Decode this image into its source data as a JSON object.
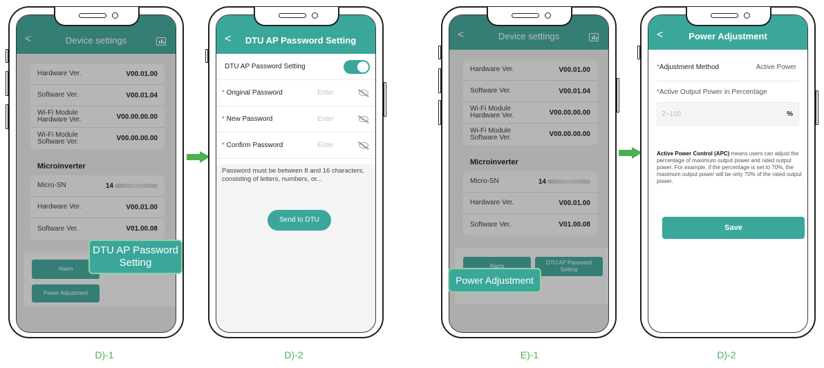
{
  "panels": {
    "d1": {
      "title": "Device settings",
      "back": "<",
      "dtu_rows": [
        {
          "key": "Hardware Ver.",
          "value": "V00.01.00"
        },
        {
          "key": "Software Ver.",
          "value": "V00.01.04"
        },
        {
          "key": "Wi-Fi Module Hardware Ver.",
          "value": "V00.00.00.00"
        },
        {
          "key": "Wi-Fi Module Software Ver.",
          "value": "V00.00.00.00"
        }
      ],
      "micro_section": "Microinverter",
      "micro_rows": [
        {
          "key": "Micro-SN",
          "value": "14"
        },
        {
          "key": "Hardware Ver.",
          "value": "V00.01.00"
        },
        {
          "key": "Software Ver.",
          "value": "V01.00.08"
        }
      ],
      "alarm_button": "Alarm",
      "power_adjustment_button": "Power Adjustment",
      "callout": "DTU AP Password Setting",
      "caption": "D)-1"
    },
    "d2": {
      "title": "DTU AP Password Setting",
      "back": "<",
      "toggle_label": "DTU AP Password Setting",
      "toggle_on": true,
      "fields": [
        {
          "label": "Original Password",
          "placeholder": "Enter"
        },
        {
          "label": "New Password",
          "placeholder": "Enter"
        },
        {
          "label": "Confirm Password",
          "placeholder": "Enter"
        }
      ],
      "hint": "Password must be between 8 and 16 characters, consisting of letters, numbers, or...",
      "send_button": "Send to DTU",
      "caption": "D)-2"
    },
    "e1": {
      "title": "Device settings",
      "back": "<",
      "dtu_rows": [
        {
          "key": "Hardware Ver.",
          "value": "V00.01.00"
        },
        {
          "key": "Software Ver.",
          "value": "V00.01.04"
        },
        {
          "key": "Wi-Fi Module Hardware Ver.",
          "value": "V00.00.00.00"
        },
        {
          "key": "Wi-Fi Module Software Ver.",
          "value": "V00.00.00.00"
        }
      ],
      "micro_section": "Microinverter",
      "micro_rows": [
        {
          "key": "Micro-SN",
          "value": "14"
        },
        {
          "key": "Hardware Ver.",
          "value": "V00.01.00"
        },
        {
          "key": "Software Ver.",
          "value": "V01.00.08"
        }
      ],
      "alarm_button": "Alarm",
      "dtu_ap_button": "DTU AP Password Setting",
      "callout": "Power Adjustment",
      "caption": "E)-1"
    },
    "d2b": {
      "title": "Power Adjustment",
      "back": "<",
      "method_label": "Adjustment Method",
      "method_value": "Active Power",
      "output_label": "Active Output Power in Percentage",
      "input_placeholder": "2~100",
      "input_unit": "%",
      "desc_bold": "Active Power Control (APC)",
      "desc_rest": " means users can adjust the percentage of maximum output power and rated output power. For example, if the percentage is set to 70%, the maximum output power will be only 70% of the rated output power.",
      "save_button": "Save",
      "caption": "D)-2"
    }
  },
  "colors": {
    "accent": "#3aa79a",
    "arrow": "#4caf50",
    "required": "#e53935"
  },
  "icons": [
    "chevron-left-icon",
    "chart-icon",
    "eye-off-icon",
    "arrow-right-icon"
  ]
}
